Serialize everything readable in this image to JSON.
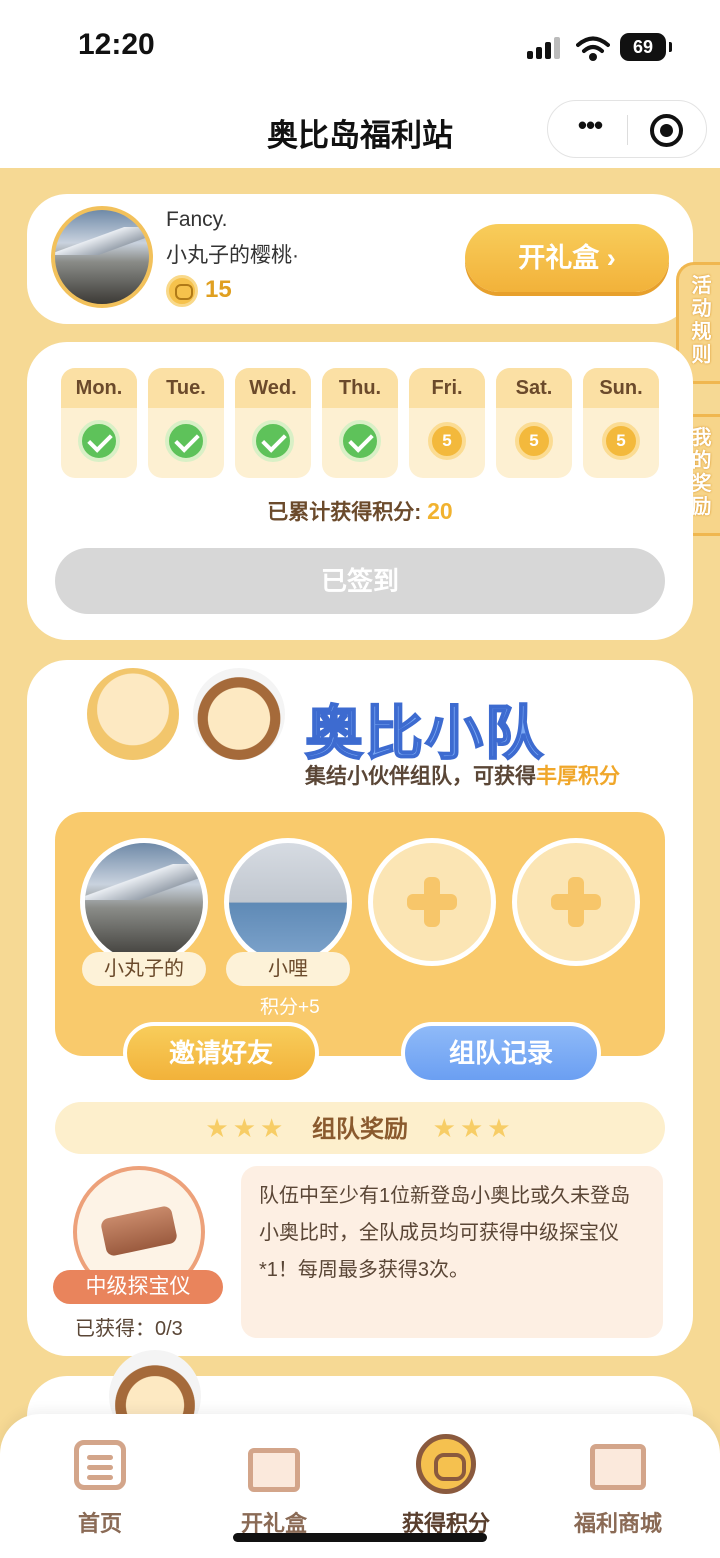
{
  "status_bar": {
    "time": "12:20",
    "battery": "69"
  },
  "nav": {
    "title": "奥比岛福利站"
  },
  "profile": {
    "name": "Fancy.",
    "nickname": "小丸子的樱桃·",
    "points": "15",
    "open_box_label": "开礼盒 ›"
  },
  "side_tabs": {
    "rules": "活动规则",
    "my_rewards": "我的奖励"
  },
  "signin": {
    "days": [
      {
        "name": "Mon.",
        "state": "checked"
      },
      {
        "name": "Tue.",
        "state": "checked"
      },
      {
        "name": "Wed.",
        "state": "checked"
      },
      {
        "name": "Thu.",
        "state": "checked"
      },
      {
        "name": "Fri.",
        "state": "pending",
        "reward": "5"
      },
      {
        "name": "Sat.",
        "state": "pending",
        "reward": "5"
      },
      {
        "name": "Sun.",
        "state": "pending",
        "reward": "5"
      }
    ],
    "total_label": "已累计获得积分:",
    "total_value": "20",
    "signed_label": "已签到"
  },
  "team": {
    "title": "奥比小队",
    "subtitle_prefix": "集结小伙伴组队，可获得",
    "subtitle_highlight": "丰厚积分",
    "members": [
      {
        "name": "小丸子的"
      },
      {
        "name": "小哩",
        "points": "积分+5"
      }
    ],
    "invite_label": "邀请好友",
    "record_label": "组队记录",
    "reward_title": "组队奖励",
    "stars": "★★★",
    "prize": {
      "name": "中级探宝仪",
      "obtained": "已获得：0/3",
      "description": "队伍中至少有1位新登岛小奥比或久未登岛小奥比时，全队成员均可获得中级探宝仪*1！每周最多获得3次。"
    }
  },
  "tabbar": {
    "items": [
      {
        "label": "首页",
        "icon": "list-icon"
      },
      {
        "label": "开礼盒",
        "icon": "gift-icon"
      },
      {
        "label": "获得积分",
        "icon": "points-icon"
      },
      {
        "label": "福利商城",
        "icon": "shop-icon"
      }
    ],
    "active_index": 2
  },
  "colors": {
    "background": "#f6d994",
    "accent": "#f2b23a",
    "blue": "#6b9ff2",
    "check": "#5ec25a"
  }
}
